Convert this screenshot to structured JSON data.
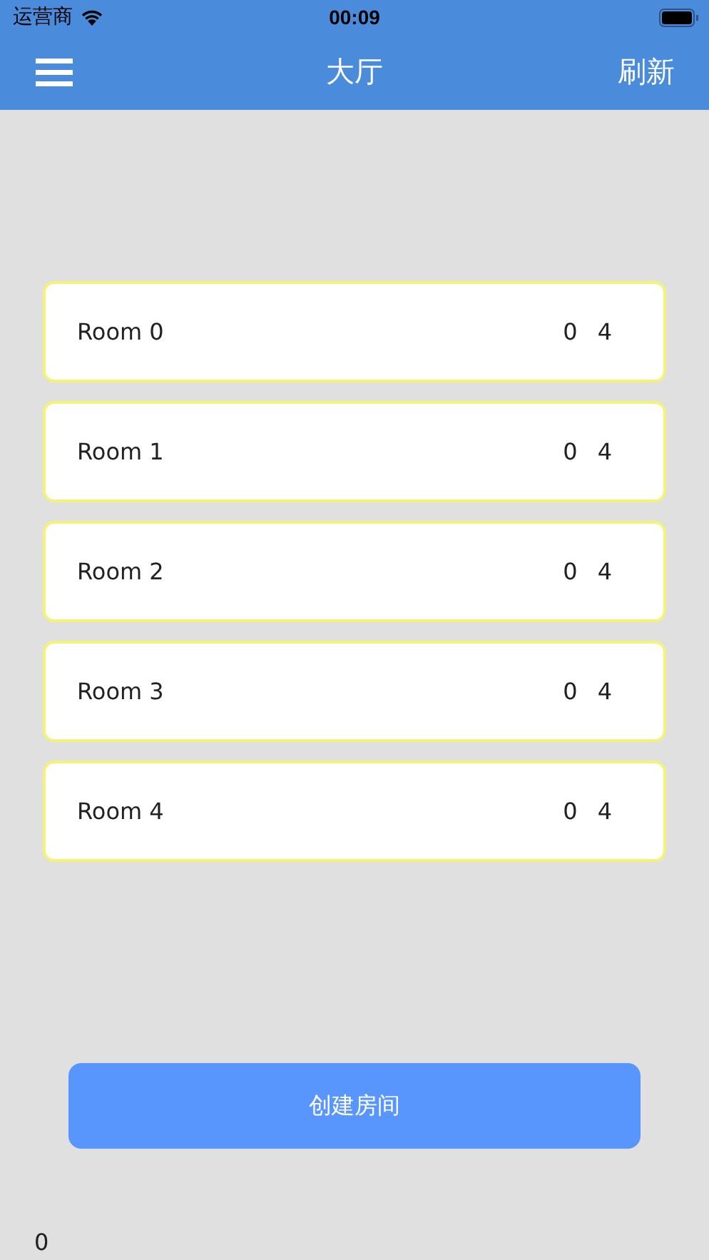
{
  "status_bar": {
    "carrier": "运营商",
    "time": "00:09"
  },
  "nav": {
    "title": "大厅",
    "refresh": "刷新"
  },
  "rooms": [
    {
      "name": "Room 0",
      "players": "0",
      "capacity": "4"
    },
    {
      "name": "Room 1",
      "players": "0",
      "capacity": "4"
    },
    {
      "name": "Room 2",
      "players": "0",
      "capacity": "4"
    },
    {
      "name": "Room 3",
      "players": "0",
      "capacity": "4"
    },
    {
      "name": "Room 4",
      "players": "0",
      "capacity": "4"
    }
  ],
  "create_button": "创建房间",
  "footer": "0"
}
